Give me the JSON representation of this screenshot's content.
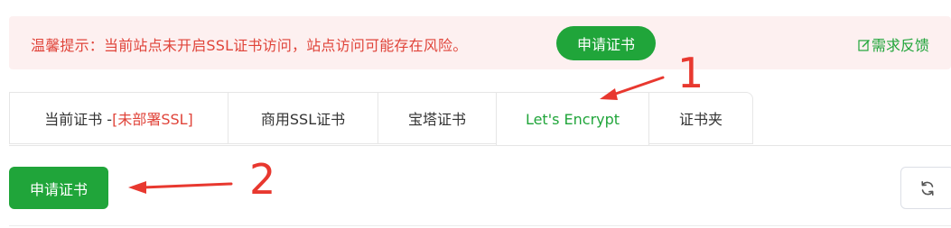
{
  "banner": {
    "message": "温馨提示：当前站点未开启SSL证书访问，站点访问可能存在风险。",
    "apply_button_label": "申请证书",
    "feedback_label": "需求反馈"
  },
  "tabs": [
    {
      "label": "当前证书 -",
      "suffix": "[未部署SSL]",
      "active": false
    },
    {
      "label": "商用SSL证书",
      "active": false
    },
    {
      "label": "宝塔证书",
      "active": false
    },
    {
      "label": "Let's Encrypt",
      "active": true
    },
    {
      "label": "证书夹",
      "active": false
    }
  ],
  "toolbar": {
    "apply_button_label": "申请证书"
  },
  "annotations": {
    "step1": "1",
    "step2": "2"
  },
  "colors": {
    "accent_green": "#20a53a",
    "warning_red": "#e0443a",
    "banner_bg": "#fdf0f0",
    "annotation_red": "#e8382f"
  },
  "icons": {
    "feedback": "edit-icon",
    "refresh": "refresh-icon"
  }
}
